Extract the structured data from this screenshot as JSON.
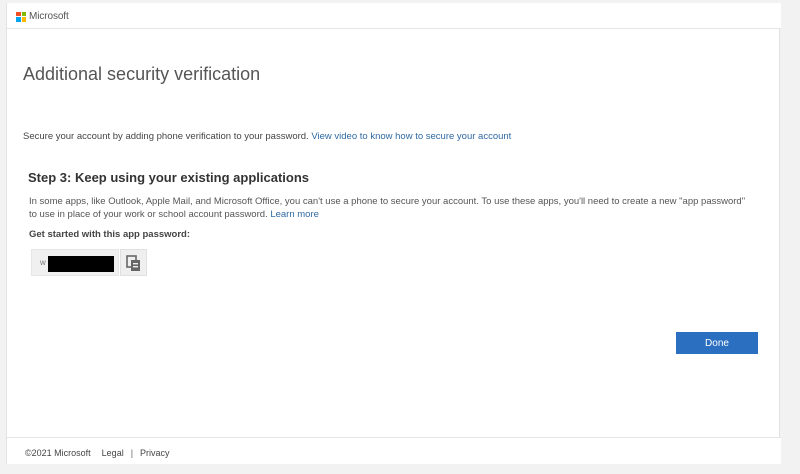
{
  "header": {
    "brand": "Microsoft",
    "logo_colors": [
      "#f25022",
      "#7fba00",
      "#00a4ef",
      "#ffb900"
    ]
  },
  "main": {
    "title": "Additional security verification",
    "intro_text": "Secure your account by adding phone verification to your password.",
    "intro_link": "View video to know how to secure your account",
    "step_title": "Step 3: Keep using your existing applications",
    "step_desc": "In some apps, like Outlook, Apple Mail, and Microsoft Office, you can't use a phone to secure your account. To use these apps, you'll need to create a new \"app password\" to use in place of your work or school account password.",
    "learn_more": "Learn more",
    "pw_label": "Get started with this app password:",
    "pw_prefix": "w",
    "copy_icon": "copy-icon",
    "done_label": "Done",
    "accent_color": "#2b6fc1"
  },
  "footer": {
    "copyright": "©2021 Microsoft",
    "legal": "Legal",
    "separator": "|",
    "privacy": "Privacy"
  }
}
